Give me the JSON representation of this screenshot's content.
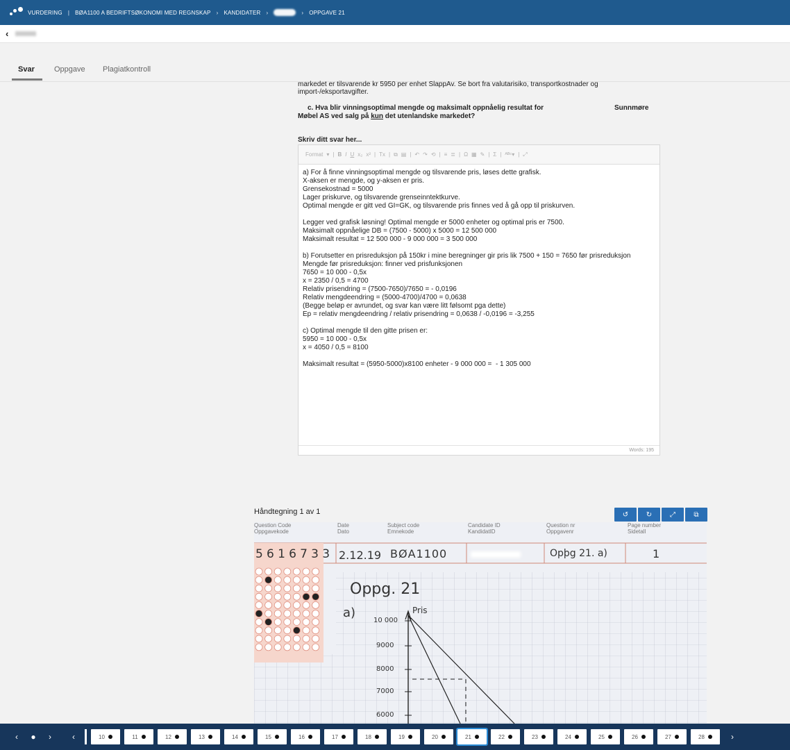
{
  "topbar": {
    "crumbs": [
      "VURDERING",
      "BØA1100 A BEDRIFTSØKONOMI MED REGNSKAP",
      "KANDIDATER",
      "OPPGAVE 21"
    ]
  },
  "subbar": {
    "back_icon": "chevron-left-icon"
  },
  "tabs": [
    "Svar",
    "Oppgave",
    "Plagiatkontroll"
  ],
  "question": {
    "intro_lines": [
      "markedet er tilsvarende kr 5950 per enhet SlappAv. Se bort fra valutarisiko, transportkostnader og",
      "import-/eksportavgifter."
    ],
    "line1": "c. Hva blir vinningsoptimal mengde og maksimalt oppnåelig resultat for",
    "line1_right": "Sunnmøre",
    "line2_a": "Møbel AS ved salg på ",
    "line2_u": "kun",
    "line2_b": " det utenlandske markedet?",
    "prompt": "Skriv ditt svar her..."
  },
  "editor": {
    "format_label": "Format",
    "lines": [
      "a) For å finne vinningsoptimal mengde og tilsvarende pris, løses dette grafisk.",
      "X-aksen er mengde, og y-aksen er pris.",
      "Grensekostnad = 5000",
      "Lager priskurve, og tilsvarende grenseinntektkurve.",
      "Optimal mengde er gitt ved GI=GK, og tilsvarende pris finnes ved å gå opp til priskurven.",
      "",
      "Legger ved grafisk løsning! Optimal mengde er 5000 enheter og optimal pris er 7500.",
      "Maksimalt oppnåelige DB = (7500 - 5000) x 5000 = 12 500 000",
      "Maksimalt resultat = 12 500 000 - 9 000 000 = 3 500 000",
      "",
      "b) Forutsetter en prisreduksjon på 150kr i mine beregninger gir pris lik 7500 + 150 = 7650 før prisreduksjon",
      "Mengde før prisreduksjon: finner ved prisfunksjonen",
      "7650 = 10 000 - 0,5x",
      "x = 2350 / 0,5 = 4700",
      "Relativ prisendring = (7500-7650)/7650 = - 0,0196",
      "Relativ mengdeendring = (5000-4700)/4700 = 0,0638",
      "(Begge beløp er avrundet, og svar kan være litt følsomt pga dette)",
      "Ep = relativ mengdeendring / relativ prisendring = 0,0638 / -0,0196 = -3,255",
      "",
      "c) Optimal mengde til den gitte prisen er:",
      "5950 = 10 000 - 0,5x",
      "x = 4050 / 0,5 = 8100",
      "",
      "Maksimalt resultat = (5950-5000)x8100 enheter - 9 000 000 =  - 1 305 000"
    ],
    "words": "Words: 195"
  },
  "handdrawing": {
    "title": "Håndtegning 1 av 1",
    "buttons": [
      "rotate-left-icon",
      "rotate-right-icon",
      "expand-icon",
      "open-external-icon"
    ],
    "header_labels": [
      {
        "en": "Question Code",
        "no": "Oppgavekode"
      },
      {
        "en": "Date",
        "no": "Dato"
      },
      {
        "en": "Subject code",
        "no": "Emnekode"
      },
      {
        "en": "Candidate ID",
        "no": "KandidatID"
      },
      {
        "en": "Question nr",
        "no": "Oppgavenr"
      },
      {
        "en": "Page number",
        "no": "Sidetall"
      }
    ],
    "code_digits": [
      "5",
      "6",
      "1",
      "6",
      "7",
      "3",
      "3"
    ],
    "date": "2.12.19",
    "subject": "BØA1100",
    "question_nr": "Opþg 21. a)",
    "page_nr": "1",
    "heading": "Oppg. 21",
    "part": "a)",
    "axis_label": "Pris",
    "ticks": [
      "10 000",
      "9000",
      "8000",
      "7000",
      "6000"
    ]
  },
  "bottombar": {
    "pages": [
      "10",
      "11",
      "12",
      "13",
      "14",
      "15",
      "16",
      "17",
      "18",
      "19",
      "20",
      "21",
      "22",
      "23",
      "24",
      "25",
      "26",
      "27",
      "28"
    ],
    "active": "21"
  }
}
